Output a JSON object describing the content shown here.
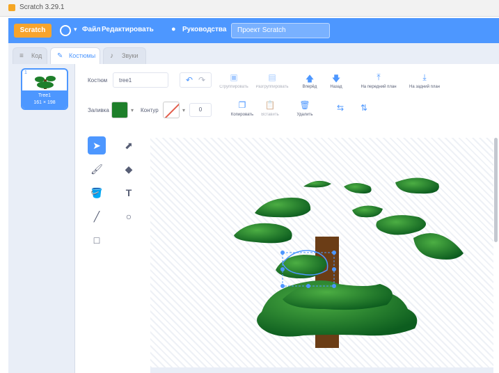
{
  "window": {
    "title": "Scratch 3.29.1"
  },
  "menubar": {
    "logo": "Scratch",
    "items": [
      "Файл",
      "Редактировать",
      "Руководства"
    ],
    "project_title": "Проект Scratch"
  },
  "tabs": [
    {
      "label": "Код",
      "icon": "code-icon"
    },
    {
      "label": "Костюмы",
      "icon": "brush-icon"
    },
    {
      "label": "Звуки",
      "icon": "sound-icon"
    }
  ],
  "costume": {
    "number": "1",
    "name": "Tree1",
    "size": "161 × 198"
  },
  "toolbar": {
    "costume_label": "Костюм",
    "costume_name": "tree1",
    "buttons_top": [
      "Сгруппировать",
      "Разгруппировать",
      "Вперёд",
      "Назад",
      "На передний план",
      "На задний план"
    ],
    "fill_label": "Заливка",
    "stroke_label": "Контур",
    "stroke_size": "0",
    "buttons_bottom": [
      "Копировать",
      "Вставить",
      "Удалить"
    ]
  },
  "tools": [
    "select-tool",
    "reshape-tool",
    "brush-tool",
    "eraser-tool",
    "fill-tool",
    "text-tool",
    "line-tool",
    "circle-tool",
    "rectangle-tool"
  ],
  "colors": {
    "accent": "#4d97ff",
    "fill": "#1e7f2a",
    "trunk": "#6b3d16",
    "leaf_light": "#4cae43",
    "leaf_dark": "#0d5d1f"
  }
}
